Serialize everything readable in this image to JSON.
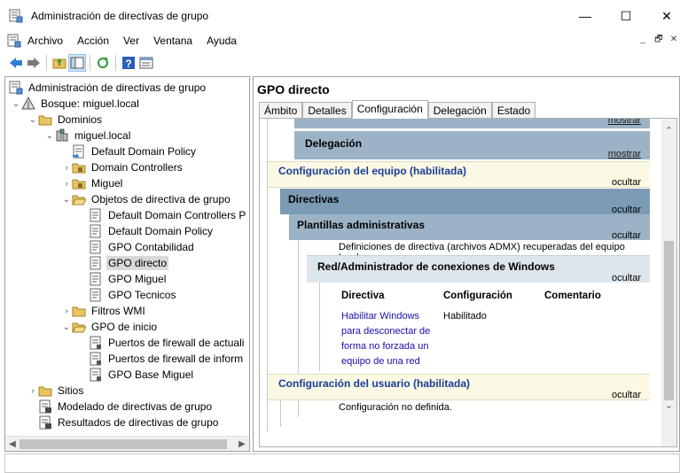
{
  "window": {
    "title": "Administración de directivas de grupo",
    "controls": [
      "—",
      "☐",
      "✕"
    ]
  },
  "menu": {
    "items": [
      "Archivo",
      "Acción",
      "Ver",
      "Ventana",
      "Ayuda"
    ],
    "mdi_controls": [
      "_",
      "🗗",
      "✕"
    ]
  },
  "toolbar": {
    "buttons": [
      "back-icon",
      "forward-icon",
      "up-folder-icon",
      "show-hide-tree-icon",
      "refresh-icon",
      "help-icon",
      "properties-icon"
    ]
  },
  "tree": {
    "root": "Administración de directivas de grupo",
    "forest": "Bosque: miguel.local",
    "domains": "Dominios",
    "domain": "miguel.local",
    "default_policy": "Default Domain Policy",
    "domain_controllers": "Domain Controllers",
    "miguel_ou": "Miguel",
    "gpo_objects": "Objetos de directiva de grupo",
    "gpo_items": [
      "Default Domain Controllers P",
      "Default Domain Policy",
      "GPO Contabilidad",
      "GPO directo",
      "GPO Miguel",
      "GPO Tecnicos"
    ],
    "wmi_filters": "Filtros WMI",
    "starter_gpos": "GPO de inicio",
    "starter_items": [
      "Puertos de firewall de actuali",
      "Puertos de firewall de inform",
      "GPO Base Miguel"
    ],
    "sites": "Sitios",
    "modeling": "Modelado de directivas de grupo",
    "results": "Resultados de directivas de grupo"
  },
  "details": {
    "title": "GPO directo",
    "tabs": [
      "Ámbito",
      "Detalles",
      "Configuración",
      "Delegación",
      "Estado"
    ],
    "active_tab": "Configuración",
    "report": {
      "top_show": "mostrar",
      "delegation": "Delegación",
      "delegation_show": "mostrar",
      "computer_config": "Configuración del equipo (habilitada)",
      "hide": "ocultar",
      "policies": "Directivas",
      "admin_templates": "Plantillas administrativas",
      "admx_note": "Definiciones de directiva (archivos ADMX) recuperadas del equipo local.",
      "net_section": "Red/Administrador de conexiones de Windows",
      "col_policy": "Directiva",
      "col_setting": "Configuración",
      "col_comment": "Comentario",
      "policy_name_lines": [
        "Habilitar Windows",
        "para desconectar de",
        "forma no forzada un",
        "equipo de una red"
      ],
      "policy_value": "Habilitado",
      "user_config": "Configuración del usuario (habilitada)",
      "user_note": "Configuración no definida."
    }
  },
  "colors": {
    "section_yellow": "#fbf8e3",
    "dark_blue_bar": "#7c9bb4",
    "medium_blue_bar": "#9cb3c5",
    "light_blue_bar": "#dde6ed",
    "link_blue": "#1a0dab",
    "section_text_blue": "#1a3e9a"
  }
}
